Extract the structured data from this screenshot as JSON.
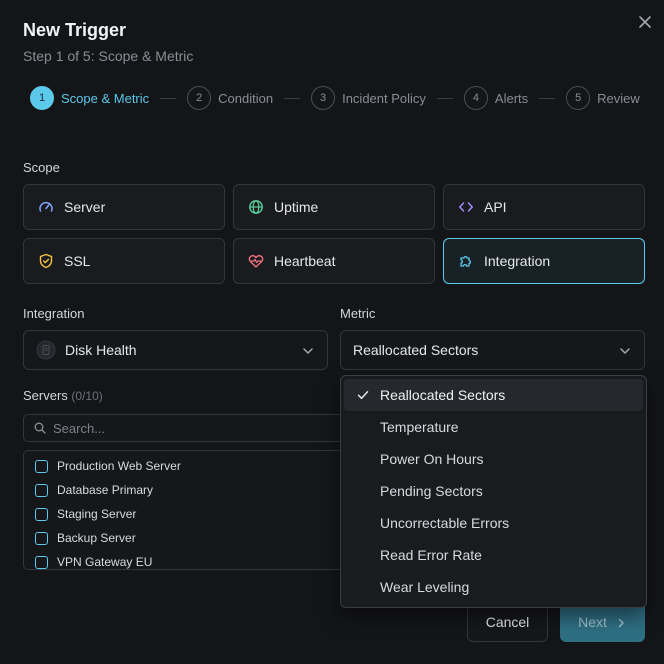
{
  "dialog": {
    "title": "New Trigger",
    "subtitle": "Step 1 of 5: Scope & Metric"
  },
  "steps": [
    {
      "num": "1",
      "label": "Scope & Metric",
      "active": true
    },
    {
      "num": "2",
      "label": "Condition",
      "active": false
    },
    {
      "num": "3",
      "label": "Incident Policy",
      "active": false
    },
    {
      "num": "4",
      "label": "Alerts",
      "active": false
    },
    {
      "num": "5",
      "label": "Review",
      "active": false
    }
  ],
  "scope": {
    "label": "Scope",
    "options": [
      {
        "label": "Server",
        "icon": "gauge-icon",
        "selected": false
      },
      {
        "label": "Uptime",
        "icon": "globe-icon",
        "selected": false
      },
      {
        "label": "API",
        "icon": "code-icon",
        "selected": false
      },
      {
        "label": "SSL",
        "icon": "shield-icon",
        "selected": false
      },
      {
        "label": "Heartbeat",
        "icon": "heart-pulse-icon",
        "selected": false
      },
      {
        "label": "Integration",
        "icon": "puzzle-icon",
        "selected": true
      }
    ]
  },
  "integration": {
    "label": "Integration",
    "value": "Disk Health",
    "icon": "disk-icon"
  },
  "metric": {
    "label": "Metric",
    "value": "Reallocated Sectors",
    "options": [
      "Reallocated Sectors",
      "Temperature",
      "Power On Hours",
      "Pending Sectors",
      "Uncorrectable Errors",
      "Read Error Rate",
      "Wear Leveling"
    ]
  },
  "servers": {
    "label": "Servers",
    "count": "(0/10)",
    "search_placeholder": "Search...",
    "items": [
      "Production Web Server",
      "Database Primary",
      "Staging Server",
      "Backup Server",
      "VPN Gateway EU"
    ]
  },
  "footer": {
    "cancel_label": "Cancel",
    "next_label": "Next"
  },
  "colors": {
    "accent": "#5cc8ea",
    "background": "#141518",
    "border": "#33363d"
  }
}
